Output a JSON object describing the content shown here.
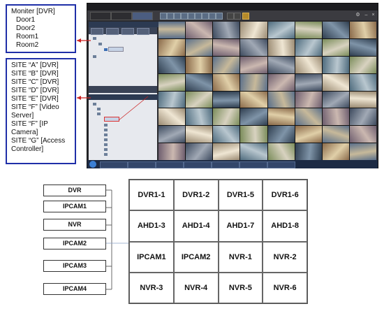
{
  "monitor_box": {
    "title": "Moniter [DVR]",
    "items": [
      "Door1",
      "Door2",
      "Room1",
      "Room2"
    ]
  },
  "site_box": {
    "lines": [
      "SITE “A” [DVR]",
      "SITE “B” [DVR]",
      "SITE “C” [DVR]",
      "SITE “D” [DVR]",
      "SITE “E” [DVR]",
      "SITE “F” [Video Server]",
      "SITE “F” [IP Camera]",
      "SITE “G” [Access Controller]"
    ]
  },
  "app": {
    "colors": {
      "accent": "#2c3a52",
      "callout_border": "#1f2fa8",
      "arrow": "#cc2222"
    }
  },
  "diagram": {
    "sources": [
      "DVR",
      "IPCAM1",
      "NVR",
      "IPCAM2",
      "IPCAM3",
      "IPCAM4"
    ],
    "grid": [
      [
        "DVR1-1",
        "DVR1-2",
        "DVR1-5",
        "DVR1-6"
      ],
      [
        "AHD1-3",
        "AHD1-4",
        "AHD1-7",
        "AHD1-8"
      ],
      [
        "IPCAM1",
        "IPCAM2",
        "NVR-1",
        "NVR-2"
      ],
      [
        "NVR-3",
        "NVR-4",
        "NVR-5",
        "NVR-6"
      ]
    ]
  }
}
